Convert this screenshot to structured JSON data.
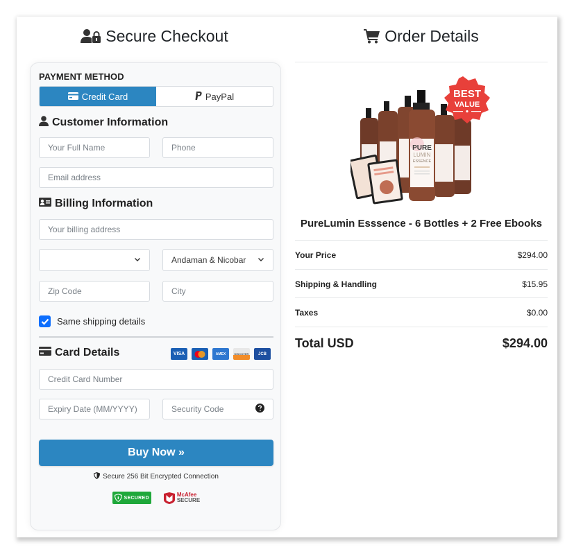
{
  "left": {
    "title": "Secure Checkout",
    "payment_method": {
      "label": "PAYMENT METHOD",
      "tabs": [
        {
          "label": "Credit Card",
          "icon": "credit-card-icon",
          "active": true
        },
        {
          "label": "PayPal",
          "icon": "paypal-icon",
          "active": false
        }
      ]
    },
    "customer_info": {
      "heading": "Customer Information",
      "full_name_placeholder": "Your Full Name",
      "phone_placeholder": "Phone",
      "email_placeholder": "Email address"
    },
    "billing_info": {
      "heading": "Billing Information",
      "address_placeholder": "Your billing address",
      "country_value": "",
      "state_value": "Andaman & Nicobar",
      "zip_placeholder": "Zip Code",
      "city_placeholder": "City",
      "same_shipping_label": "Same shipping details",
      "same_shipping_checked": true
    },
    "card_details": {
      "heading": "Card Details",
      "brands": [
        "VISA",
        "MasterCard",
        "AMEX",
        "DISCOVER",
        "JCB"
      ],
      "card_number_placeholder": "Credit Card Number",
      "expiry_placeholder": "Expiry Date (MM/YYYY)",
      "cvv_placeholder": "Security Code"
    },
    "buy_button": "Buy Now »",
    "secure_text": "Secure 256 Bit Encrypted Connection",
    "badges": {
      "secured": "SECURED",
      "mcafee_top": "McAfee",
      "mcafee_bottom": "SECURE"
    }
  },
  "right": {
    "title": "Order Details",
    "image_badge": {
      "line1": "BEST",
      "line2": "VALUE"
    },
    "product_label": {
      "line1": "PURE",
      "line2": "LUMIN",
      "line3": "ESSENCE"
    },
    "product_name": "PureLumin Esssence - 6 Bottles + 2 Free Ebooks",
    "rows": [
      {
        "label": "Your Price",
        "value": "$294.00"
      },
      {
        "label": "Shipping & Handling",
        "value": "$15.95"
      },
      {
        "label": "Taxes",
        "value": "$0.00"
      }
    ],
    "total": {
      "label": "Total USD",
      "value": "$294.00"
    }
  },
  "colors": {
    "primary": "#2c86c1",
    "checkbox": "#0d6efd",
    "badge_red": "#e8403a"
  }
}
